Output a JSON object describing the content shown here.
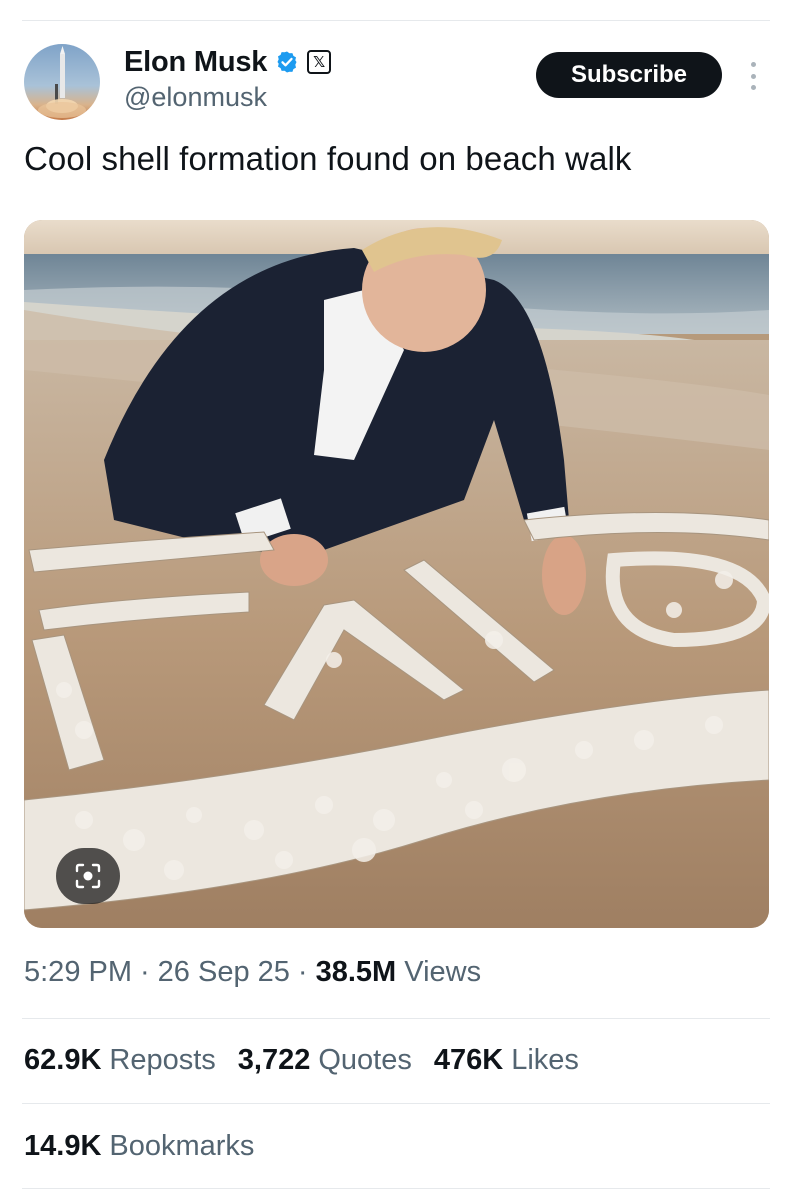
{
  "author": {
    "name": "Elon Musk",
    "handle": "@elonmusk",
    "avatar_icon": "rocket-launch-avatar",
    "verified_color": "#1d9bf0",
    "affiliate_badge": "𝕏"
  },
  "actions": {
    "subscribe_label": "Subscribe"
  },
  "tweet": {
    "text": "Cool shell formation found on beach walk",
    "media_icon": "lens-search-icon"
  },
  "meta": {
    "time": "5:29 PM",
    "sep1": "·",
    "date": "26 Sep 25",
    "sep2": "·",
    "views_count": "38.5M",
    "views_label": "Views"
  },
  "stats": {
    "reposts_count": "62.9K",
    "reposts_label": "Reposts",
    "quotes_count": "3,722",
    "quotes_label": "Quotes",
    "likes_count": "476K",
    "likes_label": "Likes",
    "bookmarks_count": "14.9K",
    "bookmarks_label": "Bookmarks"
  },
  "colors": {
    "text_primary": "#0f1419",
    "text_secondary": "#536471",
    "divider": "#e6e9ec"
  }
}
